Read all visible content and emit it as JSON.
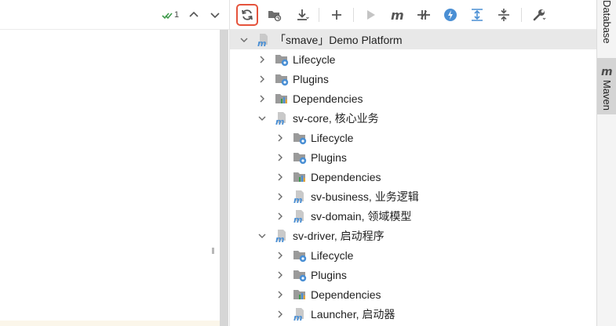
{
  "inspection": {
    "count": "1"
  },
  "toolbar": {
    "buttons": [
      {
        "icon": "reload-icon",
        "label": ""
      },
      {
        "icon": "add-folder-icon",
        "label": ""
      },
      {
        "icon": "download-icon",
        "label": ""
      },
      {
        "icon": "plus-icon",
        "label": ""
      },
      {
        "icon": "run-icon",
        "label": ""
      },
      {
        "icon": "maven-goal-icon",
        "label": ""
      },
      {
        "icon": "skip-tests-icon",
        "label": ""
      },
      {
        "icon": "offline-icon",
        "label": ""
      },
      {
        "icon": "expand-all-icon",
        "label": ""
      },
      {
        "icon": "collapse-all-icon",
        "label": ""
      },
      {
        "icon": "settings-wrench-icon",
        "label": ""
      }
    ],
    "highlighted": "reload-icon"
  },
  "tree": [
    {
      "label": "「smave」Demo Platform",
      "level": 0,
      "icon": "maven-module-icon",
      "expanded": true,
      "selected": true
    },
    {
      "label": "Lifecycle",
      "level": 1,
      "icon": "lifecycle-folder-icon",
      "expanded": false
    },
    {
      "label": "Plugins",
      "level": 1,
      "icon": "plugins-folder-icon",
      "expanded": false
    },
    {
      "label": "Dependencies",
      "level": 1,
      "icon": "dependencies-icon",
      "expanded": false
    },
    {
      "label": "sv-core, 核心业务",
      "level": 1,
      "icon": "maven-module-icon",
      "expanded": true
    },
    {
      "label": "Lifecycle",
      "level": 2,
      "icon": "lifecycle-folder-icon",
      "expanded": false
    },
    {
      "label": "Plugins",
      "level": 2,
      "icon": "plugins-folder-icon",
      "expanded": false
    },
    {
      "label": "Dependencies",
      "level": 2,
      "icon": "dependencies-icon",
      "expanded": false
    },
    {
      "label": "sv-business, 业务逻辑",
      "level": 2,
      "icon": "maven-module-icon",
      "expanded": false
    },
    {
      "label": "sv-domain, 领域模型",
      "level": 2,
      "icon": "maven-module-icon",
      "expanded": false
    },
    {
      "label": "sv-driver, 启动程序",
      "level": 1,
      "icon": "maven-module-icon",
      "expanded": true
    },
    {
      "label": "Lifecycle",
      "level": 2,
      "icon": "lifecycle-folder-icon",
      "expanded": false
    },
    {
      "label": "Plugins",
      "level": 2,
      "icon": "plugins-folder-icon",
      "expanded": false
    },
    {
      "label": "Dependencies",
      "level": 2,
      "icon": "dependencies-icon",
      "expanded": false
    },
    {
      "label": "Launcher, 启动器",
      "level": 2,
      "icon": "maven-module-icon",
      "expanded": false
    }
  ],
  "side_stripe": {
    "database_label": "Database",
    "maven_label": "Maven",
    "maven_icon": "maven-m-icon"
  },
  "colors": {
    "accent_blue": "#4a8fd4",
    "highlight_red": "#e5533c",
    "selected_row": "#e8e8e8",
    "active_stripe": "#d4d4d4"
  }
}
